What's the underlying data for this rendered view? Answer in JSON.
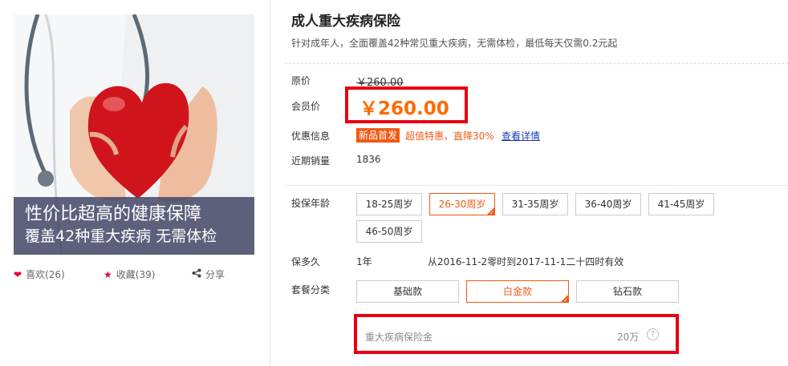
{
  "product": {
    "title": "成人重大疾病保险",
    "subtitle": "针对成年人，全面覆盖42种常见重大疾病，无需体检，最低每天仅需0.2元起"
  },
  "image": {
    "icon": "heart-in-hands-image",
    "banner_line1": "性价比超高的健康保障",
    "banner_line2": "覆盖42种重大疾病  无需体检"
  },
  "actions": {
    "like_icon": "heart-icon",
    "like_label": "喜欢(26)",
    "favorite_icon": "star-icon",
    "favorite_label": "收藏(39)",
    "share_icon": "share-icon",
    "share_label": "分享"
  },
  "price": {
    "original_label": "原价",
    "original_value": "￥260.00",
    "member_label": "会员价",
    "member_value": "￥260.00"
  },
  "promo": {
    "label": "优惠信息",
    "badge": "新品首发",
    "text": "超值特惠，直降30%",
    "link": "查看详情"
  },
  "sales": {
    "label": "近期销量",
    "value": "1836"
  },
  "age": {
    "label": "投保年龄",
    "selected": "26-30周岁",
    "options": [
      "18-25周岁",
      "26-30周岁",
      "31-35周岁",
      "36-40周岁",
      "41-45周岁",
      "46-50周岁"
    ]
  },
  "term": {
    "label": "保多久",
    "value": "1年",
    "period": "从2016-11-2零时到2017-11-1二十四时有效"
  },
  "plan": {
    "label": "套餐分类",
    "selected": "白金款",
    "options": [
      "基础款",
      "白金款",
      "钻石款"
    ]
  },
  "coverage": {
    "label": "重大疾病保险金",
    "value": "20万",
    "help_icon": "question-circle-icon",
    "help_glyph": "?"
  },
  "colors": {
    "accent": "#f05a16",
    "price": "#ff6a00",
    "highlight_border": "#e60012",
    "link": "#1a3fb8"
  }
}
